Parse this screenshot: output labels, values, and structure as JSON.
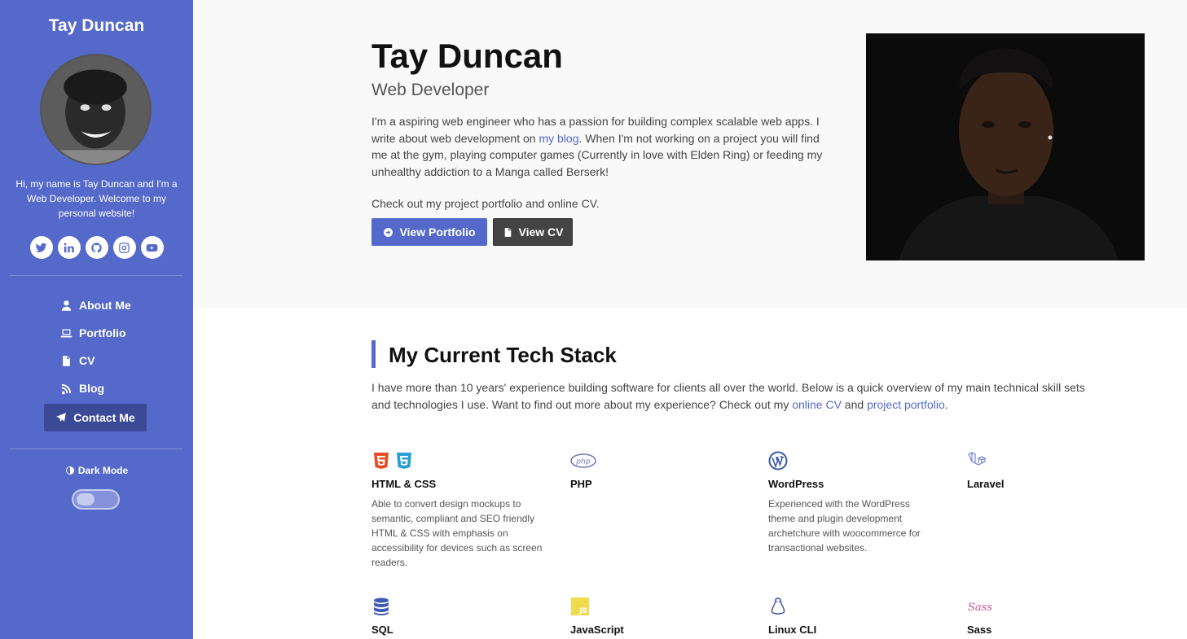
{
  "sidebar": {
    "name": "Tay Duncan",
    "bio": "Hi, my name is Tay Duncan and I'm a Web Developer. Welcome to my personal website!",
    "social_icons": [
      "twitter-icon",
      "linkedin-icon",
      "github-icon",
      "instagram-icon",
      "youtube-icon"
    ],
    "nav": [
      {
        "label": "About Me",
        "icon": "user-icon"
      },
      {
        "label": "Portfolio",
        "icon": "laptop-icon"
      },
      {
        "label": "CV",
        "icon": "file-icon"
      },
      {
        "label": "Blog",
        "icon": "blog-icon"
      }
    ],
    "contact_label": "Contact Me",
    "dark_mode_label": "Dark Mode",
    "dark_mode_on": false,
    "bg_color": "#5469c9"
  },
  "hero": {
    "name": "Tay Duncan",
    "role": "Web Developer",
    "bio_part1": "I'm a aspiring web engineer who has a passion for building complex scalable web apps. I write about web development on ",
    "bio_link": "my blog",
    "bio_part2": ". When I'm not working on a project you will find me at the gym, playing computer games (Currently in love with Elden Ring) or feeding my unhealthy addiction to a Manga called Berserk!",
    "links_prefix": "Check out my project ",
    "link_portfolio": "portfolio",
    "links_and": " and ",
    "link_cv": "online CV",
    "links_suffix": ".",
    "btn_portfolio": "View Portfolio",
    "btn_cv": "View CV"
  },
  "stack": {
    "title": "My Current Tech Stack",
    "desc_part1": "I have more than 10 years' experience building software for clients all over the world. Below is a quick overview of my main technical skill sets and technologies I use. Want to find out more about my experience? Check out my ",
    "desc_link1": "online CV",
    "desc_and": " and ",
    "desc_link2": "project portfolio",
    "desc_suffix": ".",
    "skills": [
      {
        "name": "HTML & CSS",
        "desc": "Able to convert design mockups to semantic, compliant and SEO friendly HTML & CSS with emphasis on accessibility for devices such as screen readers."
      },
      {
        "name": "PHP",
        "desc": ""
      },
      {
        "name": "WordPress",
        "desc": "Experienced with the WordPress theme and plugin development archetchure with woocommerce for transactional websites."
      },
      {
        "name": "Laravel",
        "desc": ""
      },
      {
        "name": "SQL",
        "desc": ""
      },
      {
        "name": "JavaScript",
        "desc": ""
      },
      {
        "name": "Linux CLI",
        "desc": ""
      },
      {
        "name": "Sass",
        "desc": ""
      }
    ]
  },
  "colors": {
    "accent": "#5469c9",
    "dark_button": "#444444"
  }
}
